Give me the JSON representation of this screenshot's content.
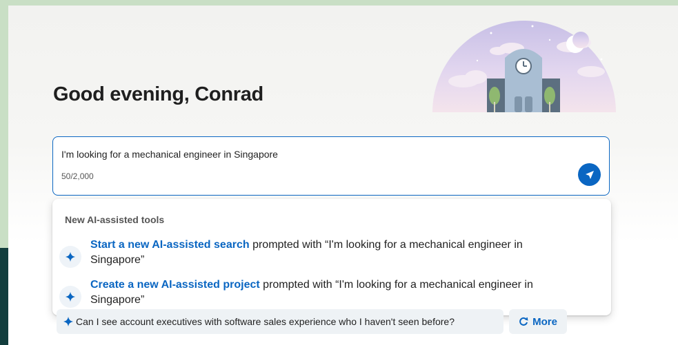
{
  "greeting": "Good evening, Conrad",
  "search": {
    "value": "I'm looking for a mechanical engineer in Singapore",
    "char_count": "50/2,000"
  },
  "dropdown": {
    "header": "New AI-assisted tools",
    "options": [
      {
        "link": "Start a new AI-assisted search",
        "rest": " prompted with “I'm looking for a mechanical engineer in Singapore”"
      },
      {
        "link": "Create a new AI-assisted project",
        "rest": " prompted with “I'm looking for a mechanical engineer in Singapore”"
      }
    ]
  },
  "suggestions": {
    "prompt": "Can I see account executives with software sales experience who I haven't seen before?",
    "more_label": "More"
  },
  "icons": {
    "send": "send-icon",
    "sparkle": "sparkle-icon",
    "refresh": "refresh-icon"
  },
  "colors": {
    "accent": "#0a66c2",
    "text": "#1f1f1f",
    "muted": "#555555"
  }
}
